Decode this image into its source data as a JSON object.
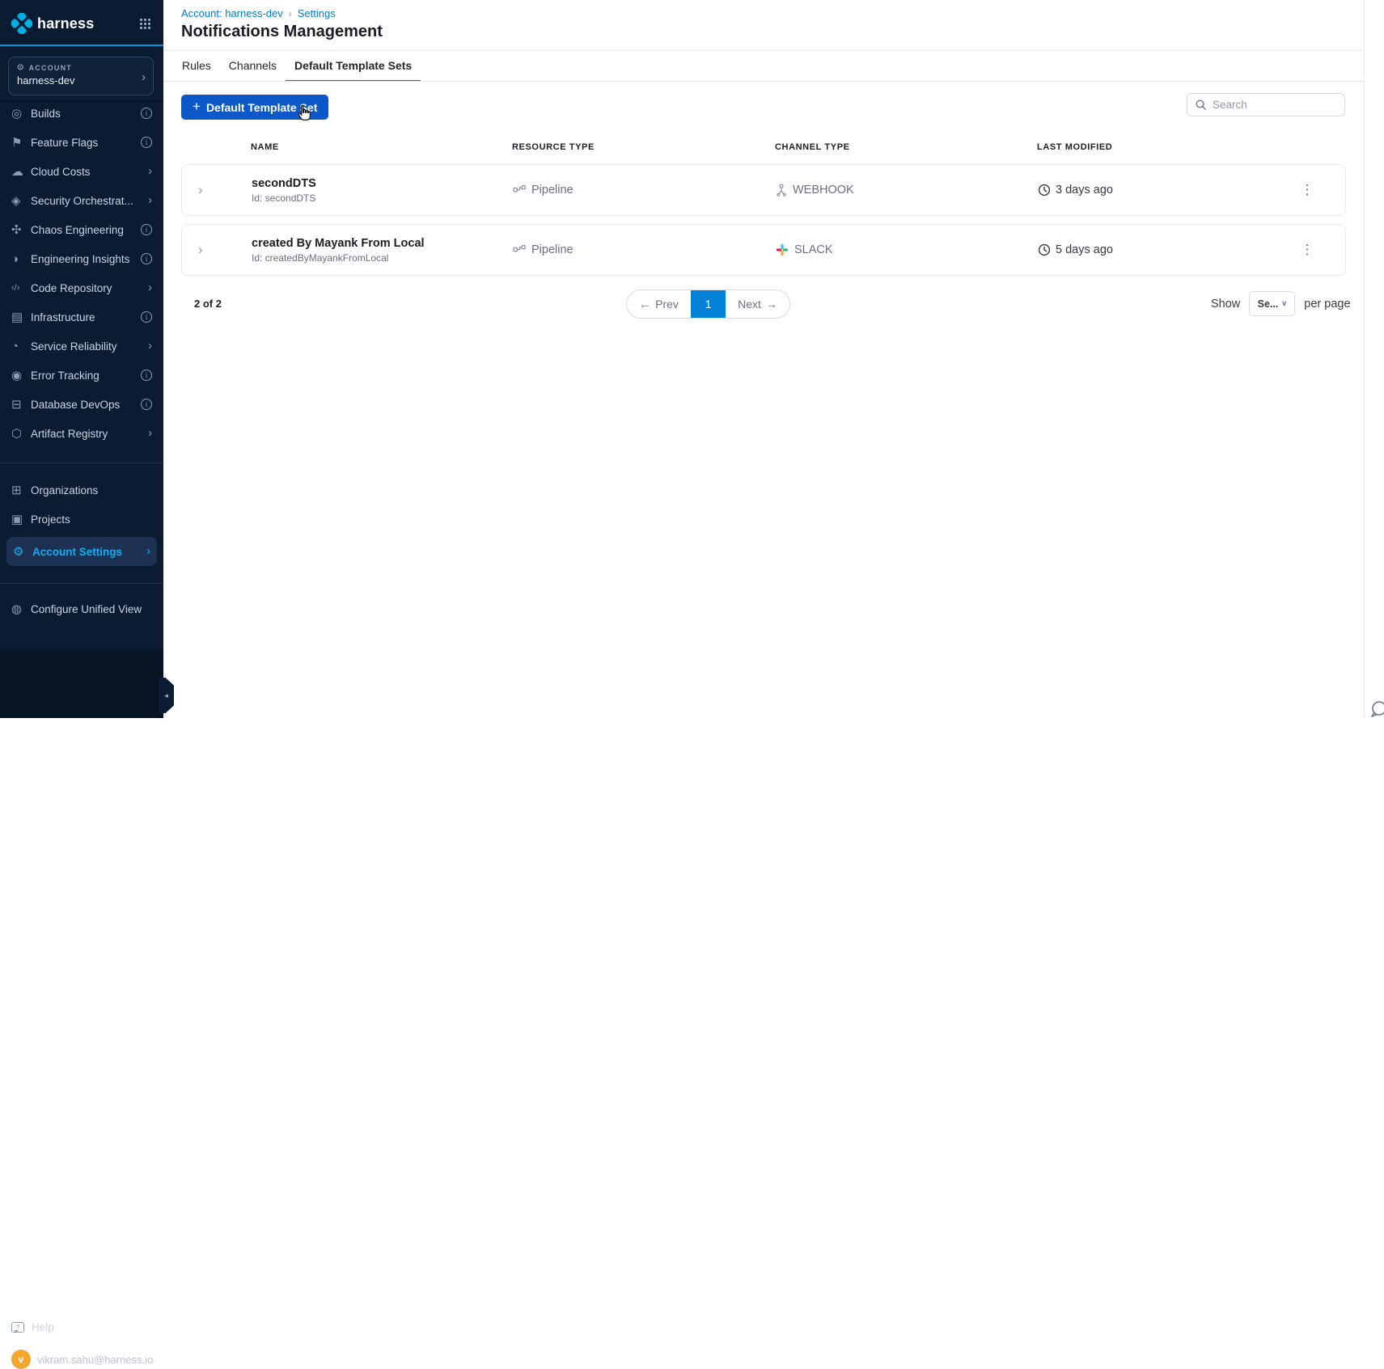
{
  "colors": {
    "accent": "#0278d5",
    "button_blue": "#0d58c9",
    "page_active_bg": "#0182d8",
    "sidebar_bg": "#0a1b32",
    "sidebar_active_text": "#0eb0f5",
    "avatar_bg": "#f2a72e",
    "slack_icon": [
      "#36C5F0",
      "#2EB67D",
      "#ECB22E",
      "#E01E5A"
    ]
  },
  "sidebar": {
    "logo_text": "harness",
    "account": {
      "label": "ACCOUNT",
      "name": "harness-dev",
      "icon_glyph": "⊙",
      "chevron": "›"
    },
    "modules": [
      {
        "label": "Builds",
        "glyph": "◎"
      },
      {
        "label": "Feature Flags",
        "glyph": "⚑"
      },
      {
        "label": "Cloud Costs",
        "glyph": "☁"
      },
      {
        "label": "Security Orchestrat...",
        "glyph": "◈"
      },
      {
        "label": "Chaos Engineering",
        "glyph": "✣"
      },
      {
        "label": "Engineering Insights",
        "glyph": "◑"
      },
      {
        "label": "Code Repository",
        "glyph": "‹/›"
      },
      {
        "label": "Infrastructure",
        "glyph": "▤"
      },
      {
        "label": "Service Reliability",
        "glyph": "◔"
      },
      {
        "label": "Error Tracking",
        "glyph": "◉"
      },
      {
        "label": "Database DevOps",
        "glyph": "⊟"
      },
      {
        "label": "Artifact Registry",
        "glyph": "⬡"
      }
    ],
    "nav": [
      {
        "label": "Organizations",
        "glyph": "⊞"
      },
      {
        "label": "Projects",
        "glyph": "▣"
      },
      {
        "label": "Account Settings",
        "glyph": "⚙",
        "chevron": "›"
      }
    ],
    "configure": {
      "label": "Configure Unified View",
      "glyph": "◍"
    },
    "help": {
      "label": "Help"
    },
    "user": {
      "initial": "v",
      "email": "vikram.sahu@harness.io"
    },
    "collapse_glyph": "◂"
  },
  "header": {
    "breadcrumb": {
      "account": "Account: harness-dev",
      "separator": "›",
      "settings": "Settings"
    },
    "title": "Notifications Management",
    "tabs": [
      {
        "label": "Rules"
      },
      {
        "label": "Channels"
      },
      {
        "label": "Default Template Sets"
      }
    ]
  },
  "toolbar": {
    "add_button_plus": "+",
    "add_button_label": "Default Template Set",
    "search_placeholder": "Search"
  },
  "table": {
    "headers": [
      "NAME",
      "RESOURCE TYPE",
      "CHANNEL TYPE",
      "LAST MODIFIED"
    ],
    "row_chevron": "›",
    "kebab_glyph": "⋮",
    "rows": [
      {
        "name": "secondDTS",
        "id": "Id: secondDTS",
        "resource": "Pipeline",
        "channel": "WEBHOOK",
        "channel_icon": "webhook-icon",
        "modified": "3 days ago"
      },
      {
        "name": "created By Mayank From Local",
        "id": "Id: createdByMayankFromLocal",
        "resource": "Pipeline",
        "channel": "SLACK",
        "channel_icon": "slack-icon",
        "modified": "5 days ago"
      }
    ]
  },
  "pagination": {
    "count": "2 of 2",
    "prev_arrow": "←",
    "prev": "Prev",
    "page": "1",
    "next": "Next",
    "next_arrow": "→",
    "show": "Show",
    "page_size": "Se...",
    "per_page": "per page"
  }
}
